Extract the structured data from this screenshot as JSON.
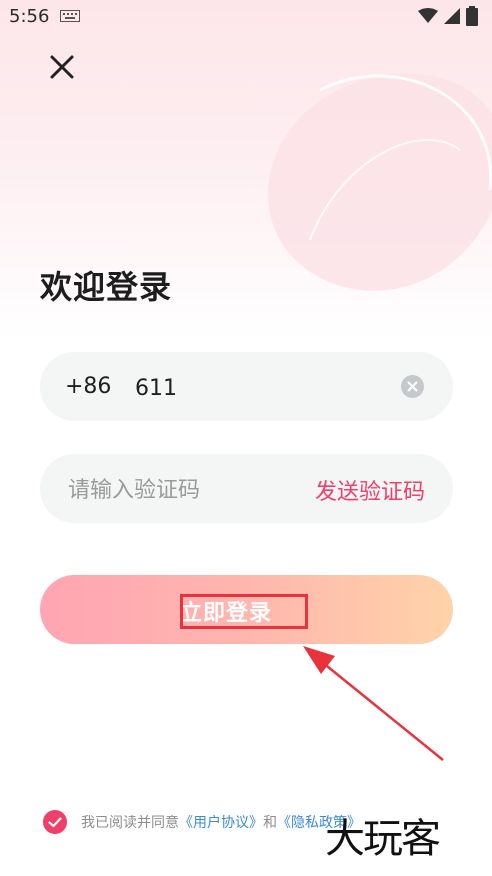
{
  "status_bar": {
    "time": "5:56"
  },
  "login": {
    "title": "欢迎登录",
    "phone": {
      "country_code": "+86",
      "value": "611"
    },
    "code": {
      "placeholder": "请输入验证码",
      "send_label": "发送验证码"
    },
    "submit_label": "立即登录"
  },
  "agreement": {
    "text": "我已阅读并同意",
    "user_agreement": "《用户协议》",
    "conjunction": "和",
    "privacy_policy": "《隐私政策》"
  },
  "watermark": "大玩客",
  "colors": {
    "accent": "#ef3f6b",
    "link": "#3d8ad8",
    "annotation_red": "#e8323c",
    "button_gradient_start": "#ffa5b3",
    "button_gradient_end": "#ffd3a9"
  }
}
